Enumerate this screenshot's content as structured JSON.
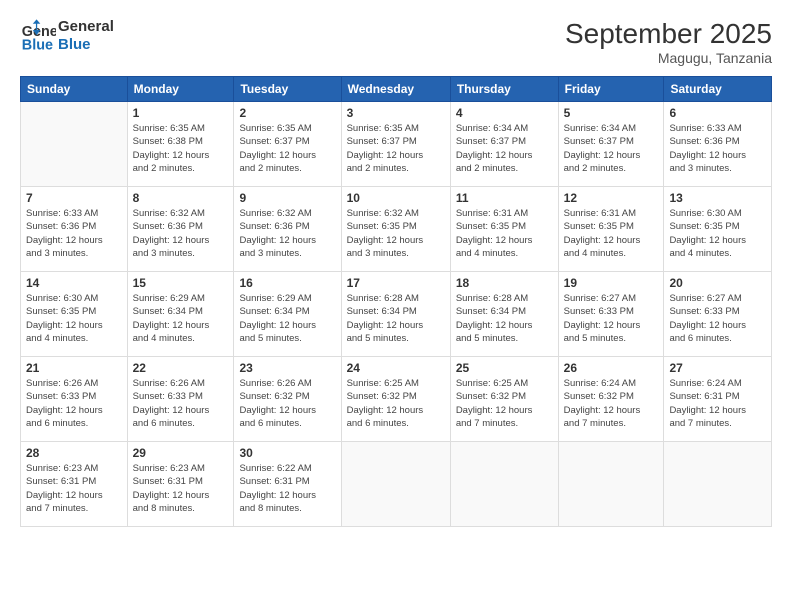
{
  "header": {
    "logo_line1": "General",
    "logo_line2": "Blue",
    "title": "September 2025",
    "subtitle": "Magugu, Tanzania"
  },
  "days_of_week": [
    "Sunday",
    "Monday",
    "Tuesday",
    "Wednesday",
    "Thursday",
    "Friday",
    "Saturday"
  ],
  "weeks": [
    [
      {
        "day": "",
        "info": ""
      },
      {
        "day": "1",
        "info": "Sunrise: 6:35 AM\nSunset: 6:38 PM\nDaylight: 12 hours\nand 2 minutes."
      },
      {
        "day": "2",
        "info": "Sunrise: 6:35 AM\nSunset: 6:37 PM\nDaylight: 12 hours\nand 2 minutes."
      },
      {
        "day": "3",
        "info": "Sunrise: 6:35 AM\nSunset: 6:37 PM\nDaylight: 12 hours\nand 2 minutes."
      },
      {
        "day": "4",
        "info": "Sunrise: 6:34 AM\nSunset: 6:37 PM\nDaylight: 12 hours\nand 2 minutes."
      },
      {
        "day": "5",
        "info": "Sunrise: 6:34 AM\nSunset: 6:37 PM\nDaylight: 12 hours\nand 2 minutes."
      },
      {
        "day": "6",
        "info": "Sunrise: 6:33 AM\nSunset: 6:36 PM\nDaylight: 12 hours\nand 3 minutes."
      }
    ],
    [
      {
        "day": "7",
        "info": "Sunrise: 6:33 AM\nSunset: 6:36 PM\nDaylight: 12 hours\nand 3 minutes."
      },
      {
        "day": "8",
        "info": "Sunrise: 6:32 AM\nSunset: 6:36 PM\nDaylight: 12 hours\nand 3 minutes."
      },
      {
        "day": "9",
        "info": "Sunrise: 6:32 AM\nSunset: 6:36 PM\nDaylight: 12 hours\nand 3 minutes."
      },
      {
        "day": "10",
        "info": "Sunrise: 6:32 AM\nSunset: 6:35 PM\nDaylight: 12 hours\nand 3 minutes."
      },
      {
        "day": "11",
        "info": "Sunrise: 6:31 AM\nSunset: 6:35 PM\nDaylight: 12 hours\nand 4 minutes."
      },
      {
        "day": "12",
        "info": "Sunrise: 6:31 AM\nSunset: 6:35 PM\nDaylight: 12 hours\nand 4 minutes."
      },
      {
        "day": "13",
        "info": "Sunrise: 6:30 AM\nSunset: 6:35 PM\nDaylight: 12 hours\nand 4 minutes."
      }
    ],
    [
      {
        "day": "14",
        "info": "Sunrise: 6:30 AM\nSunset: 6:35 PM\nDaylight: 12 hours\nand 4 minutes."
      },
      {
        "day": "15",
        "info": "Sunrise: 6:29 AM\nSunset: 6:34 PM\nDaylight: 12 hours\nand 4 minutes."
      },
      {
        "day": "16",
        "info": "Sunrise: 6:29 AM\nSunset: 6:34 PM\nDaylight: 12 hours\nand 5 minutes."
      },
      {
        "day": "17",
        "info": "Sunrise: 6:28 AM\nSunset: 6:34 PM\nDaylight: 12 hours\nand 5 minutes."
      },
      {
        "day": "18",
        "info": "Sunrise: 6:28 AM\nSunset: 6:34 PM\nDaylight: 12 hours\nand 5 minutes."
      },
      {
        "day": "19",
        "info": "Sunrise: 6:27 AM\nSunset: 6:33 PM\nDaylight: 12 hours\nand 5 minutes."
      },
      {
        "day": "20",
        "info": "Sunrise: 6:27 AM\nSunset: 6:33 PM\nDaylight: 12 hours\nand 6 minutes."
      }
    ],
    [
      {
        "day": "21",
        "info": "Sunrise: 6:26 AM\nSunset: 6:33 PM\nDaylight: 12 hours\nand 6 minutes."
      },
      {
        "day": "22",
        "info": "Sunrise: 6:26 AM\nSunset: 6:33 PM\nDaylight: 12 hours\nand 6 minutes."
      },
      {
        "day": "23",
        "info": "Sunrise: 6:26 AM\nSunset: 6:32 PM\nDaylight: 12 hours\nand 6 minutes."
      },
      {
        "day": "24",
        "info": "Sunrise: 6:25 AM\nSunset: 6:32 PM\nDaylight: 12 hours\nand 6 minutes."
      },
      {
        "day": "25",
        "info": "Sunrise: 6:25 AM\nSunset: 6:32 PM\nDaylight: 12 hours\nand 7 minutes."
      },
      {
        "day": "26",
        "info": "Sunrise: 6:24 AM\nSunset: 6:32 PM\nDaylight: 12 hours\nand 7 minutes."
      },
      {
        "day": "27",
        "info": "Sunrise: 6:24 AM\nSunset: 6:31 PM\nDaylight: 12 hours\nand 7 minutes."
      }
    ],
    [
      {
        "day": "28",
        "info": "Sunrise: 6:23 AM\nSunset: 6:31 PM\nDaylight: 12 hours\nand 7 minutes."
      },
      {
        "day": "29",
        "info": "Sunrise: 6:23 AM\nSunset: 6:31 PM\nDaylight: 12 hours\nand 8 minutes."
      },
      {
        "day": "30",
        "info": "Sunrise: 6:22 AM\nSunset: 6:31 PM\nDaylight: 12 hours\nand 8 minutes."
      },
      {
        "day": "",
        "info": ""
      },
      {
        "day": "",
        "info": ""
      },
      {
        "day": "",
        "info": ""
      },
      {
        "day": "",
        "info": ""
      }
    ]
  ]
}
